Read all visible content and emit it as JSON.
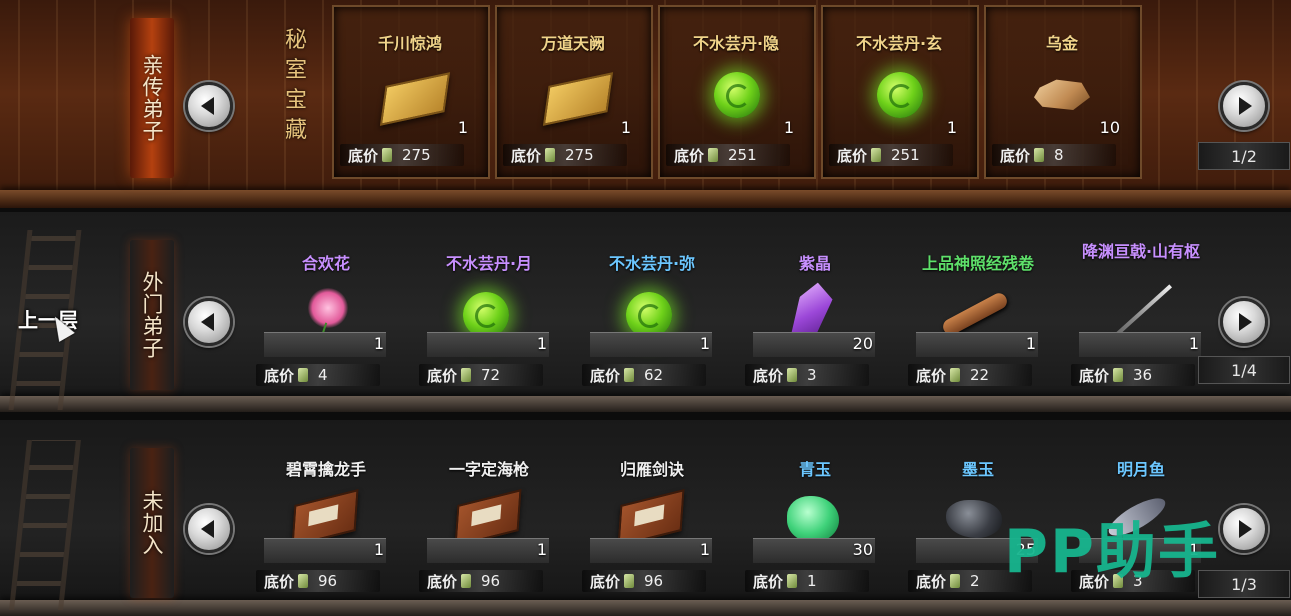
{
  "colors": {
    "name_gold": "#f1d48a",
    "name_purple": "#c890ff",
    "name_blue": "#6cc7ff",
    "name_green": "#5ee06a",
    "name_white": "#f0f0f0",
    "watermark": "#17b58e"
  },
  "floating_label": "上一层",
  "watermark": "PP助手",
  "price_label": "底价",
  "price_icon": "spirit-stone-icon",
  "rows": [
    {
      "category": "亲传弟子",
      "section_title": "秘室宝藏",
      "page": "1/2",
      "items": [
        {
          "name": "千川惊鸿",
          "qty": "1",
          "price": "275",
          "icon": "scroll-icon",
          "color": "#f1d48a"
        },
        {
          "name": "万道天阙",
          "qty": "1",
          "price": "275",
          "icon": "scroll-icon",
          "color": "#f1d48a"
        },
        {
          "name": "不水芸丹·隐",
          "qty": "1",
          "price": "251",
          "icon": "pill-icon",
          "color": "#f1d48a"
        },
        {
          "name": "不水芸丹·玄",
          "qty": "1",
          "price": "251",
          "icon": "pill-icon",
          "color": "#f1d48a"
        },
        {
          "name": "乌金",
          "qty": "10",
          "price": "8",
          "icon": "gold-ore-icon",
          "color": "#f1d48a"
        }
      ]
    },
    {
      "category": "外门弟子",
      "page": "1/4",
      "items": [
        {
          "name": "合欢花",
          "qty": "1",
          "price": "4",
          "icon": "flower-icon",
          "color": "#c890ff"
        },
        {
          "name": "不水芸丹·月",
          "qty": "1",
          "price": "72",
          "icon": "pill-icon",
          "color": "#c890ff"
        },
        {
          "name": "不水芸丹·弥",
          "qty": "1",
          "price": "62",
          "icon": "pill-icon",
          "color": "#6cc7ff"
        },
        {
          "name": "紫晶",
          "qty": "20",
          "price": "3",
          "icon": "crystal-icon",
          "color": "#c890ff"
        },
        {
          "name": "上品神照经残卷",
          "qty": "1",
          "price": "22",
          "icon": "scroll-roll-icon",
          "color": "#5ee06a"
        },
        {
          "name": "降渊亘戟·山有枢",
          "qty": "1",
          "price": "36",
          "icon": "spear-icon",
          "color": "#c890ff"
        }
      ]
    },
    {
      "category": "未加入",
      "page": "1/3",
      "items": [
        {
          "name": "碧霄擒龙手",
          "qty": "1",
          "price": "96",
          "icon": "book-icon",
          "color": "#f0f0f0"
        },
        {
          "name": "一字定海枪",
          "qty": "1",
          "price": "96",
          "icon": "book-icon",
          "color": "#f0f0f0"
        },
        {
          "name": "归雁剑诀",
          "qty": "1",
          "price": "96",
          "icon": "book-icon",
          "color": "#f0f0f0"
        },
        {
          "name": "青玉",
          "qty": "30",
          "price": "1",
          "icon": "jade-icon",
          "color": "#6cc7ff"
        },
        {
          "name": "墨玉",
          "qty": "25",
          "price": "2",
          "icon": "ink-jade-icon",
          "color": "#6cc7ff"
        },
        {
          "name": "明月鱼",
          "qty": "1",
          "price": "3",
          "icon": "fish-icon",
          "color": "#6cc7ff"
        }
      ]
    }
  ]
}
